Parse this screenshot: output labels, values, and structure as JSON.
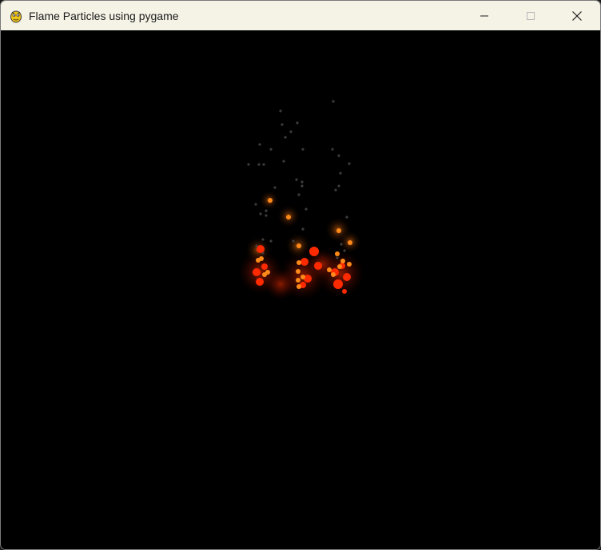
{
  "window": {
    "title": "Flame Particles using pygame",
    "icon": "pygame-snake-icon",
    "controls": {
      "minimize": "minimize-icon",
      "maximize": "maximize-icon",
      "close": "close-icon"
    }
  },
  "colors": {
    "titlebar_bg": "#f5f3e6",
    "canvas_bg": "#000000",
    "flame_core": "#ff2a00",
    "flame_mid": "#c85a10",
    "ember": "#ff8a1a",
    "smoke": "#3d3d3d"
  }
}
